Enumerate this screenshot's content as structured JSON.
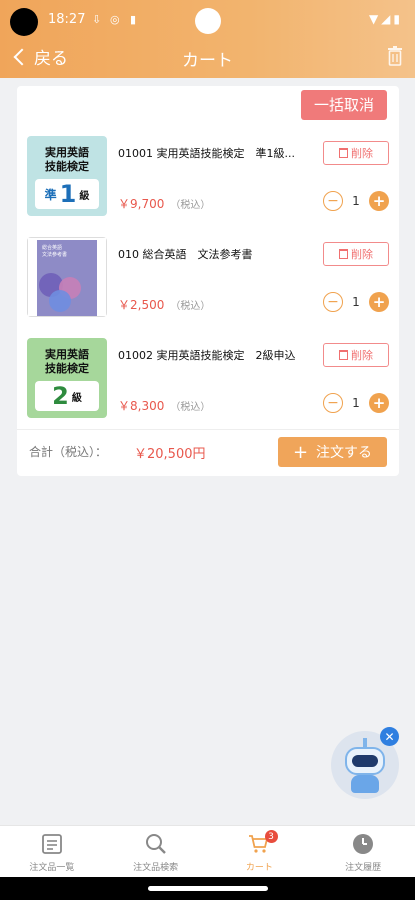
{
  "status": {
    "time": "18:27"
  },
  "nav": {
    "back_label": "戻る",
    "title": "カート"
  },
  "cart": {
    "bulk_cancel_label": "一括取消",
    "delete_label": "削除",
    "tax_label": "（税込）",
    "items": [
      {
        "name": "01001 実用英語技能検定　準1級...",
        "price": "￥9,700",
        "qty": "1",
        "thumb": {
          "title_line1": "実用英語",
          "title_line2": "技能検定",
          "grade_prefix": "準",
          "grade_number": "1",
          "grade_suffix": "級",
          "bg": "#bfe3e4",
          "number_color": "#1d6fb8"
        }
      },
      {
        "name": "010 総合英語　文法参考書",
        "price": "￥2,500",
        "qty": "1",
        "thumb": {
          "book_text_line1": "総合英語",
          "book_text_line2": "文法参考書",
          "cover": "#8e8bc6"
        }
      },
      {
        "name": "01002 実用英語技能検定　2級申込",
        "price": "￥8,300",
        "qty": "1",
        "thumb": {
          "title_line1": "実用英語",
          "title_line2": "技能検定",
          "grade_number": "2",
          "grade_suffix": "級",
          "bg": "#a6d79b",
          "number_color": "#2e8b3e"
        }
      }
    ],
    "total_label": "合計（税込）：",
    "total_value": "￥20,500円",
    "order_label": "注文する"
  },
  "tabs": [
    {
      "label": "注文品一覧",
      "icon": "list-icon"
    },
    {
      "label": "注文品検索",
      "icon": "search-icon"
    },
    {
      "label": "カート",
      "icon": "cart-icon",
      "badge": "3",
      "active": true
    },
    {
      "label": "注文履歴",
      "icon": "clock-icon"
    }
  ],
  "colors": {
    "accent": "#f0a24e",
    "header": "#f0a55a",
    "danger": "#f07a7a",
    "price": "#e8584d"
  }
}
